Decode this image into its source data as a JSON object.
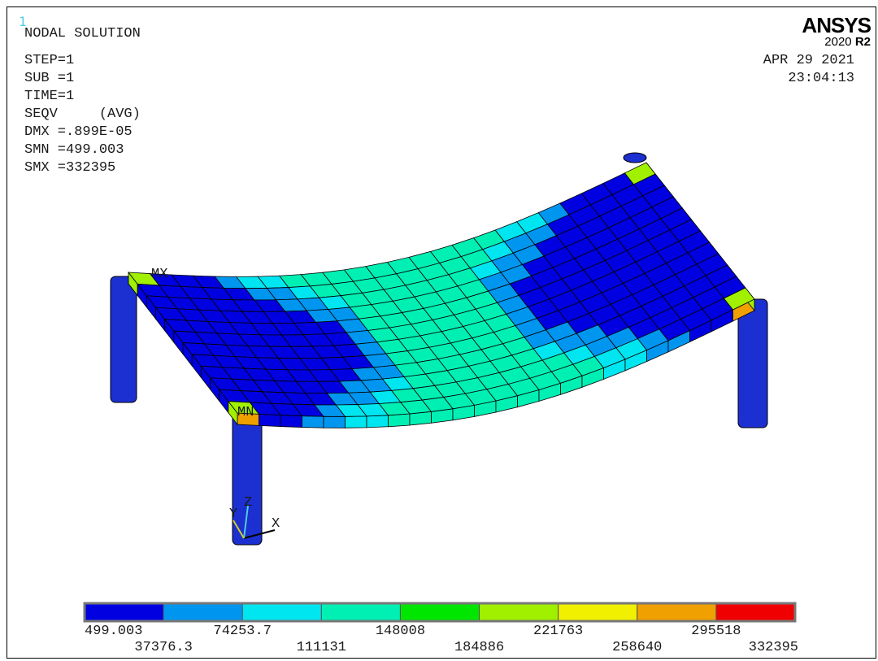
{
  "window_number": "1",
  "title": "NODAL SOLUTION",
  "info_lines": [
    "STEP=1",
    "SUB =1",
    "TIME=1",
    "SEQV     (AVG)",
    "DMX =.899E-05",
    "SMN =499.003",
    "SMX =332395"
  ],
  "date": "APR 29 2021",
  "time": "23:04:13",
  "logo": {
    "name": "ANSYS",
    "version": "2020",
    "release": "R2"
  },
  "markers": {
    "max": "MX",
    "min": "MN"
  },
  "triad": {
    "x": "X",
    "y": "Y",
    "z": "Z"
  },
  "legend": {
    "colors": [
      "#0000e0",
      "#0096f0",
      "#00e6f0",
      "#00f0b4",
      "#00e600",
      "#a0f000",
      "#f0f000",
      "#f0a000",
      "#f00000"
    ],
    "labels_top": [
      "499.003",
      "74253.7",
      "148008",
      "221763",
      "295518"
    ],
    "labels_bottom": [
      "37376.3",
      "111131",
      "184886",
      "258640",
      "332395"
    ]
  },
  "colors": {
    "mesh_line": "#000000",
    "column": "#1c2fd0",
    "background": "#ffffff"
  }
}
